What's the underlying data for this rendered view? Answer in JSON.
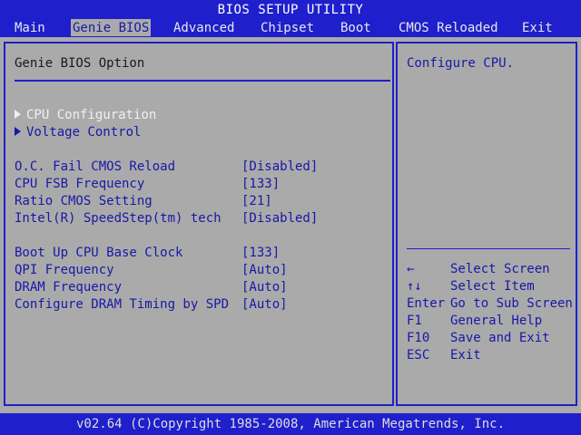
{
  "title": "BIOS SETUP UTILITY",
  "menu": [
    {
      "label": "Main",
      "active": false
    },
    {
      "label": "Genie BIOS",
      "active": true
    },
    {
      "label": "Advanced",
      "active": false
    },
    {
      "label": "Chipset",
      "active": false
    },
    {
      "label": "Boot",
      "active": false
    },
    {
      "label": "CMOS Reloaded",
      "active": false
    },
    {
      "label": "Exit",
      "active": false
    }
  ],
  "main": {
    "title": "Genie BIOS Option",
    "submenus": [
      {
        "label": "CPU Configuration"
      },
      {
        "label": "Voltage Control"
      }
    ],
    "settings_group1": [
      {
        "label": "O.C. Fail CMOS Reload",
        "value": "[Disabled]"
      },
      {
        "label": "CPU FSB Frequency",
        "value": "[133]"
      },
      {
        "label": "Ratio CMOS Setting",
        "value": "[21]"
      },
      {
        "label": "Intel(R) SpeedStep(tm) tech",
        "value": "[Disabled]"
      }
    ],
    "settings_group2": [
      {
        "label": "Boot Up CPU Base Clock",
        "value": "[133]"
      },
      {
        "label": "QPI Frequency",
        "value": "[Auto]"
      },
      {
        "label": "DRAM Frequency",
        "value": "[Auto]"
      },
      {
        "label": "Configure DRAM Timing by SPD",
        "value": "[Auto]"
      }
    ]
  },
  "help": {
    "text": "Configure CPU.",
    "keys": [
      {
        "key": "←",
        "desc": "Select Screen"
      },
      {
        "key": "↑↓",
        "desc": "Select Item"
      },
      {
        "key": "Enter",
        "desc": "Go to Sub Screen"
      },
      {
        "key": "F1",
        "desc": "General Help"
      },
      {
        "key": "F10",
        "desc": "Save and Exit"
      },
      {
        "key": "ESC",
        "desc": "Exit"
      }
    ]
  },
  "footer": "v02.64 (C)Copyright 1985-2008, American Megatrends, Inc."
}
